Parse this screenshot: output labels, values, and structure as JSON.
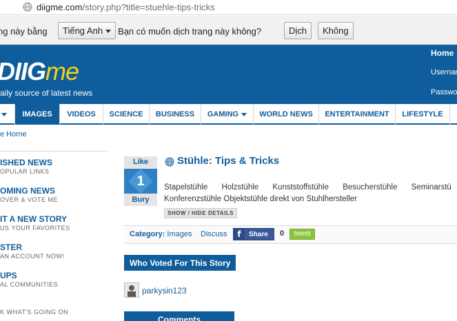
{
  "browser": {
    "url_host": "diigme.com",
    "url_path": "/story.php?title=stuehle-tips-tricks",
    "icon": "globe-icon"
  },
  "translate_bar": {
    "prefix_text": "ng này bằng",
    "language_select": "Tiếng Anh",
    "question": "Bạn có muốn dịch trang này không?",
    "translate_button": "Dịch",
    "decline_button": "Không"
  },
  "header": {
    "logo_main": "DIIG",
    "logo_accent": "me",
    "tagline": "aily source of latest news",
    "home_link": "Home",
    "username_label": "Usernan",
    "password_label": "Passwo",
    "colors": {
      "bar": "#0f5d9c",
      "logo_accent": "#f2d31b"
    }
  },
  "nav": {
    "items": [
      {
        "label": "IMAGES",
        "active": true
      },
      {
        "label": "VIDEOS",
        "active": false
      },
      {
        "label": "SCIENCE",
        "active": false
      },
      {
        "label": "BUSINESS",
        "active": false
      },
      {
        "label": "GAMING",
        "active": false,
        "dropdown": true
      },
      {
        "label": "WORLD NEWS",
        "active": false
      },
      {
        "label": "ENTERTAINMENT",
        "active": false
      },
      {
        "label": "LIFESTYLE",
        "active": false
      }
    ]
  },
  "breadcrumb": "e Home",
  "sidebar": {
    "items": [
      {
        "title": "ISHED NEWS",
        "subtitle": "OPULAR LINKS"
      },
      {
        "title": "OMING NEWS",
        "subtitle": "OVER & VOTE ME"
      },
      {
        "title": "IT A NEW STORY",
        "subtitle": "US YOUR FAVORITES"
      },
      {
        "title": "STER",
        "subtitle": "AN ACCOUNT NOW!"
      },
      {
        "title": "UPS",
        "subtitle": "AL COMMUNITIES"
      },
      {
        "title": "",
        "subtitle": "K WHAT'S GOING ON"
      }
    ]
  },
  "story": {
    "like_label": "Like",
    "vote_count": "1",
    "bury_label": "Bury",
    "title": "Stühle: Tips & Tricks",
    "description_line1": "Stapelstühle Holzstühle Kunststoffstühle Besucherstühle Seminarstü",
    "description_line2": "Konferenzstühle Objektstühle direkt von Stuhlhersteller",
    "show_hide": "SHOW / HIDE DETAILS",
    "category_label": "Category:",
    "category_value": "Images",
    "discuss": "Discuss",
    "share_label": "Share",
    "share_count": "0",
    "tweet_label": "tweet"
  },
  "voters": {
    "heading": "Who Voted For This Story",
    "list": [
      {
        "name": "parkysin123"
      }
    ]
  },
  "comments_heading": "Comments"
}
